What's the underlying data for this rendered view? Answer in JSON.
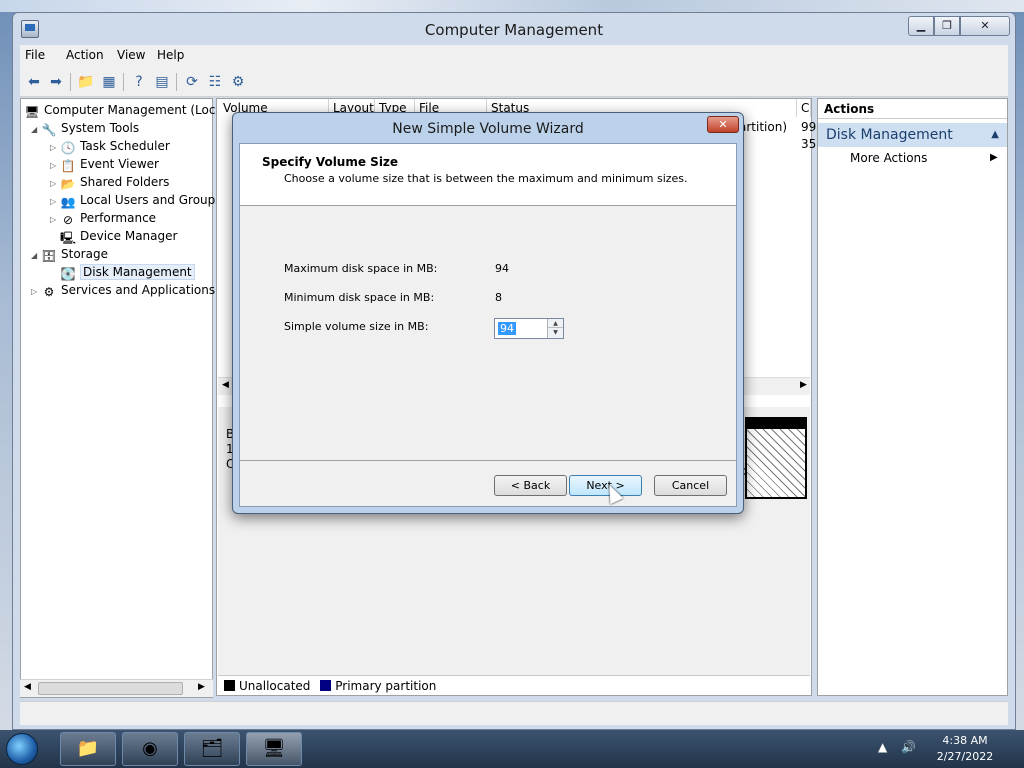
{
  "window": {
    "title": "Computer Management"
  },
  "menubar": [
    "File",
    "Action",
    "View",
    "Help"
  ],
  "tree": {
    "items": [
      {
        "label": "Computer Management (Local",
        "icon": "computer-icon",
        "level": 0,
        "toggle": ""
      },
      {
        "label": "System Tools",
        "icon": "tools-icon",
        "level": 1,
        "toggle": "◢"
      },
      {
        "label": "Task Scheduler",
        "icon": "clock-icon",
        "level": 2,
        "toggle": "▷"
      },
      {
        "label": "Event Viewer",
        "icon": "event-viewer-icon",
        "level": 2,
        "toggle": "▷"
      },
      {
        "label": "Shared Folders",
        "icon": "shared-folder-icon",
        "level": 2,
        "toggle": "▷"
      },
      {
        "label": "Local Users and Groups",
        "icon": "users-icon",
        "level": 2,
        "toggle": "▷"
      },
      {
        "label": "Performance",
        "icon": "performance-icon",
        "level": 2,
        "toggle": "▷"
      },
      {
        "label": "Device Manager",
        "icon": "device-manager-icon",
        "level": 2,
        "toggle": ""
      },
      {
        "label": "Storage",
        "icon": "storage-icon",
        "level": 1,
        "toggle": "◢"
      },
      {
        "label": "Disk Management",
        "icon": "disk-icon",
        "level": 2,
        "toggle": ""
      },
      {
        "label": "Services and Applications",
        "icon": "services-icon",
        "level": 1,
        "toggle": "▷"
      }
    ]
  },
  "columns": [
    "Volume",
    "Layout",
    "Type",
    "File System",
    "Status",
    "C"
  ],
  "center": {
    "partial_partition": "artition)",
    "partial_values": [
      "99",
      "35"
    ],
    "disk_letters": [
      "B",
      "1(",
      "O"
    ],
    "unallocated_partial": "cated"
  },
  "legend": [
    {
      "label": "Unallocated",
      "color": "#000000"
    },
    {
      "label": "Primary partition",
      "color": "#000080"
    }
  ],
  "actions": {
    "header": "Actions",
    "section": "Disk Management",
    "items": [
      "More Actions"
    ]
  },
  "dialog": {
    "title": "New Simple Volume Wizard",
    "heading": "Specify Volume Size",
    "subheading": "Choose a volume size that is between the maximum and minimum sizes.",
    "max_label": "Maximum disk space in MB:",
    "max_value": "94",
    "min_label": "Minimum disk space in MB:",
    "min_value": "8",
    "size_label": "Simple volume size in MB:",
    "size_value": "94",
    "back_label": "< Back",
    "next_label": "Next >",
    "cancel_label": "Cancel"
  },
  "taskbar": {
    "apps": [
      "explorer-icon",
      "chrome-icon",
      "folder-share-icon",
      "computer-management-icon"
    ],
    "time": "4:38 AM",
    "date": "2/27/2022"
  }
}
